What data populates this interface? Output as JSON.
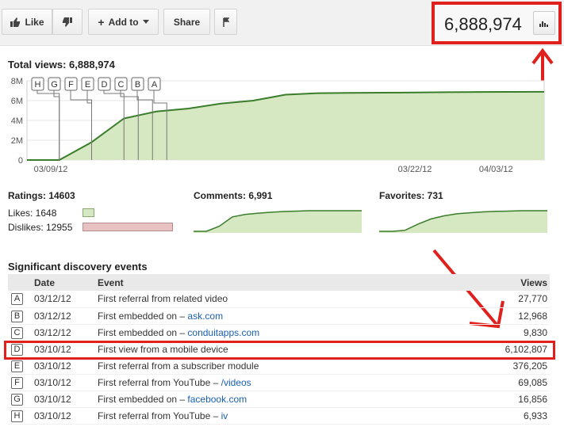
{
  "toolbar": {
    "like_label": "Like",
    "add_to_label": "Add to",
    "share_label": "Share",
    "view_count": "6,888,974"
  },
  "summary": {
    "total_views_label": "Total views: 6,888,974"
  },
  "main_chart": {
    "y_ticks": [
      "8M",
      "6M",
      "4M",
      "2M",
      "0"
    ],
    "x_ticks": [
      "03/09/12",
      "03/22/12",
      "04/03/12"
    ],
    "markers": [
      "H",
      "G",
      "F",
      "E",
      "D",
      "C",
      "B",
      "A"
    ]
  },
  "chart_data": [
    {
      "type": "area",
      "x": [
        "03/09/12",
        "03/10/12",
        "03/11/12",
        "03/12/12",
        "03/13/12",
        "03/14/12",
        "03/15/12",
        "03/16/12",
        "03/17/12",
        "03/18/12",
        "03/19/12",
        "03/20/12",
        "03/22/12",
        "03/26/12",
        "03/30/12",
        "04/03/12",
        "04/04/12"
      ],
      "values": [
        0,
        0,
        1800000,
        4200000,
        4900000,
        5200000,
        5700000,
        6000000,
        6600000,
        6750000,
        6780000,
        6800000,
        6820000,
        6850000,
        6870000,
        6880000,
        6889000
      ],
      "ylim": [
        0,
        8000000
      ],
      "y_ticks": [
        "8M",
        "6M",
        "4M",
        "2M",
        "0"
      ],
      "x_ticks": [
        "03/09/12",
        "03/22/12",
        "04/03/12"
      ],
      "title": "Total views: 6,888,974",
      "grid": true
    },
    {
      "type": "area",
      "title": "Comments: 6,991",
      "values": [
        0,
        0,
        0.25,
        0.7,
        0.82,
        0.88,
        0.93,
        0.96,
        0.98,
        1,
        1,
        1,
        1,
        1
      ]
    },
    {
      "type": "area",
      "title": "Favorites: 731",
      "values": [
        0,
        0,
        0.05,
        0.35,
        0.6,
        0.75,
        0.85,
        0.9,
        0.94,
        0.97,
        0.98,
        1,
        1,
        1
      ]
    }
  ],
  "ratings": {
    "title": "Ratings: 14603",
    "likes_label": "Likes: 1648",
    "dislikes_label": "Dislikes: 12955",
    "likes": 1648,
    "dislikes": 12955,
    "like_color": "#d6e8c2",
    "dislike_color": "#e8c2c2"
  },
  "comments": {
    "title": "Comments: 6,991"
  },
  "favorites": {
    "title": "Favorites: 731"
  },
  "events": {
    "title": "Significant discovery events",
    "columns": {
      "date": "Date",
      "event": "Event",
      "views": "Views"
    },
    "rows": [
      {
        "marker": "A",
        "date": "03/12/12",
        "text": "First referral from related video",
        "link": "",
        "views": "27,770"
      },
      {
        "marker": "B",
        "date": "03/12/12",
        "text": "First embedded on – ",
        "link": "ask.com",
        "views": "12,968"
      },
      {
        "marker": "C",
        "date": "03/12/12",
        "text": "First embedded on – ",
        "link": "conduitapps.com",
        "views": "9,830"
      },
      {
        "marker": "D",
        "date": "03/10/12",
        "text": "First view from a mobile device",
        "link": "",
        "views": "6,102,807"
      },
      {
        "marker": "E",
        "date": "03/10/12",
        "text": "First referral from a subscriber module",
        "link": "",
        "views": "376,205"
      },
      {
        "marker": "F",
        "date": "03/10/12",
        "text": "First referral from YouTube – ",
        "link": "/videos",
        "views": "69,085"
      },
      {
        "marker": "G",
        "date": "03/10/12",
        "text": "First embedded on – ",
        "link": "facebook.com",
        "views": "16,856"
      },
      {
        "marker": "H",
        "date": "03/10/12",
        "text": "First referral from YouTube – ",
        "link": "iv",
        "views": "6,933"
      }
    ]
  },
  "colors": {
    "accent_red": "#e0201c",
    "chart_line": "#3a7d2a",
    "chart_fill": "#d6e8c2",
    "link": "#1a5fb4"
  }
}
